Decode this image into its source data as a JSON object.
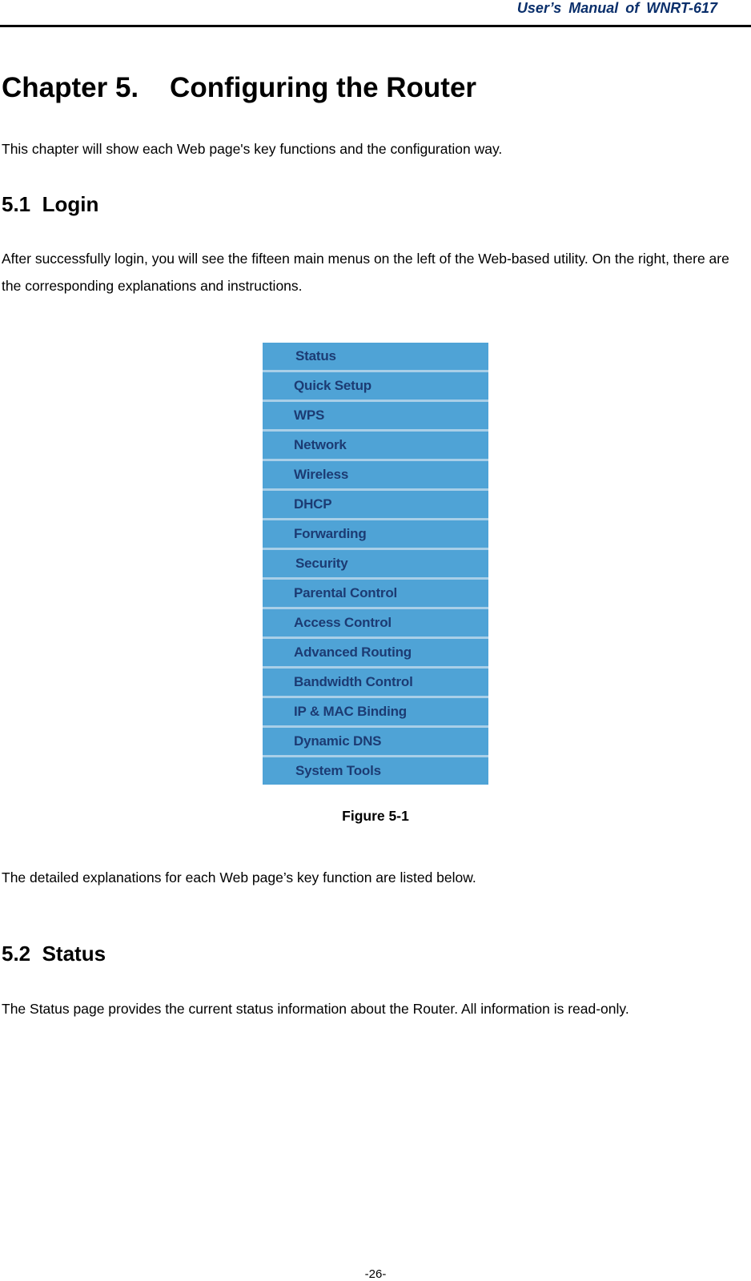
{
  "header": {
    "title": "User’s Manual of WNRT-617"
  },
  "chapter": {
    "title": "Chapter 5.    Configuring the Router",
    "intro": "This chapter will show each Web page's key functions and the configuration way."
  },
  "sections": [
    {
      "title": "5.1  Login",
      "paragraph": "After successfully login, you will see the fifteen main menus on the left of the Web-based utility. On the right, there are the corresponding explanations and instructions."
    },
    {
      "title": "5.2  Status",
      "paragraph": "The Status page provides the current status information about the Router. All information is read-only."
    }
  ],
  "figure": {
    "menu_items": [
      {
        "label": "Status"
      },
      {
        "label": "Quick Setup"
      },
      {
        "label": "WPS"
      },
      {
        "label": "Network"
      },
      {
        "label": "Wireless"
      },
      {
        "label": "DHCP"
      },
      {
        "label": "Forwarding"
      },
      {
        "label": "Security"
      },
      {
        "label": "Parental Control"
      },
      {
        "label": "Access Control"
      },
      {
        "label": "Advanced Routing"
      },
      {
        "label": "Bandwidth Control"
      },
      {
        "label": "IP & MAC Binding"
      },
      {
        "label": "Dynamic DNS"
      },
      {
        "label": "System Tools"
      }
    ],
    "caption": "Figure 5-1",
    "colors": {
      "item_background": "#4fa3d6",
      "item_separator": "#a9cfe8",
      "item_text": "#1c3b73"
    }
  },
  "after_figure_text": "The detailed explanations for each Web page’s key function are listed below.",
  "footer": {
    "page_number": "-26-"
  }
}
